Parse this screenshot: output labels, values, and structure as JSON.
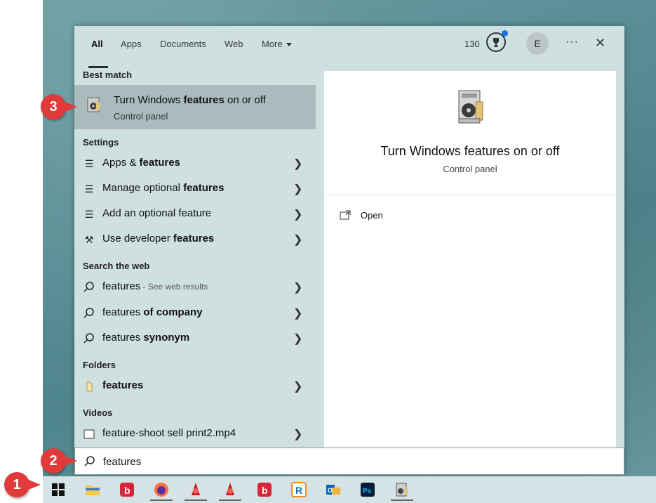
{
  "tabs": [
    {
      "label": "All"
    },
    {
      "label": "Apps"
    },
    {
      "label": "Documents"
    },
    {
      "label": "Web"
    },
    {
      "label": "More"
    }
  ],
  "header": {
    "points": "130",
    "avatar_initial": "E",
    "more_options": "···",
    "close": "✕"
  },
  "sections": {
    "best_match": "Best match",
    "settings": "Settings",
    "search_web": "Search the web",
    "folders": "Folders",
    "videos": "Videos"
  },
  "best_match": {
    "title_pre": "Turn Windows ",
    "title_bold": "features",
    "title_post": " on or off",
    "subtitle": "Control panel"
  },
  "settings_items": [
    {
      "pre": "Apps & ",
      "bold": "features",
      "post": ""
    },
    {
      "pre": "Manage optional ",
      "bold": "features",
      "post": ""
    },
    {
      "pre": "Add an optional feature",
      "bold": "",
      "post": ""
    },
    {
      "pre": "Use developer ",
      "bold": "features",
      "post": ""
    }
  ],
  "web_items": [
    {
      "pre": "features",
      "bold": "",
      "sub": " - See web results"
    },
    {
      "pre": "features ",
      "bold": "of company",
      "sub": ""
    },
    {
      "pre": "features ",
      "bold": "synonym",
      "sub": ""
    }
  ],
  "folder_item": {
    "bold": "features"
  },
  "video_item": {
    "label": "feature-shoot sell print2.mp4"
  },
  "preview": {
    "title": "Turn Windows features on or off",
    "subtitle": "Control panel",
    "open_label": "Open"
  },
  "search": {
    "value": "features"
  },
  "callouts": [
    "1",
    "2",
    "3"
  ],
  "taskbar_apps": [
    "windows-start-icon",
    "file-explorer-icon",
    "app-b-icon",
    "firefox-icon",
    "app-red-icon",
    "app-red-icon",
    "app-b-icon",
    "app-r-icon",
    "outlook-icon",
    "photoshop-icon",
    "windows-features-icon"
  ],
  "colors": {
    "accent": "#1a73e8",
    "callout": "#e03a3a",
    "panel": "#cfe0e1",
    "selected": "#a9bbbd"
  }
}
